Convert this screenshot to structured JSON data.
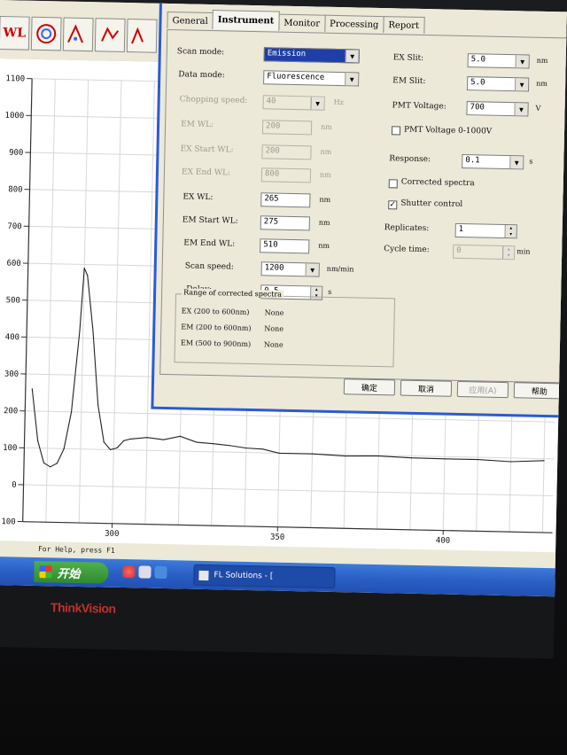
{
  "toolbar": {
    "icons": [
      "wl-icon",
      "target-icon",
      "peak-icon",
      "undo-icon",
      "zoom-icon"
    ],
    "wl_text": "WL"
  },
  "chart_data": {
    "type": "line",
    "yticks": [
      "1100",
      "1000",
      "900",
      "800",
      "700",
      "600",
      "500",
      "400",
      "300",
      "200",
      "100",
      "0",
      "-100"
    ],
    "xticks": [
      "300",
      "350",
      "400"
    ],
    "x": [
      275,
      277,
      279,
      281,
      283,
      285,
      287,
      289,
      290,
      291,
      293,
      295,
      297,
      299,
      301,
      303,
      305,
      310,
      315,
      320,
      325,
      330,
      335,
      340,
      345,
      350,
      360,
      370,
      380,
      390,
      400,
      410,
      420,
      430
    ],
    "y": [
      260,
      120,
      60,
      50,
      60,
      100,
      200,
      420,
      590,
      570,
      420,
      220,
      120,
      100,
      105,
      125,
      130,
      135,
      130,
      140,
      125,
      122,
      118,
      112,
      110,
      100,
      100,
      96,
      98,
      95,
      94,
      94,
      90,
      95
    ],
    "ylim": [
      -100,
      1100
    ],
    "xlim": [
      273,
      433
    ],
    "grid": true
  },
  "status": {
    "text": "For Help, press F1"
  },
  "taskbar": {
    "start": "开始",
    "task_label": "FL Solutions - ["
  },
  "brand": "ThinkVision",
  "dialog": {
    "tabs": [
      "General",
      "Instrument",
      "Monitor",
      "Processing",
      "Report"
    ],
    "active_tab": "Instrument",
    "left": {
      "scan_mode": {
        "label": "Scan mode:",
        "value": "Emission"
      },
      "data_mode": {
        "label": "Data mode:",
        "value": "Fluorescence"
      },
      "chopping_speed": {
        "label": "Chopping speed:",
        "value": "40",
        "unit": "Hz"
      },
      "em_wl": {
        "label": "EM WL:",
        "value": "200",
        "unit": "nm"
      },
      "ex_start_wl": {
        "label": "EX Start WL:",
        "value": "200",
        "unit": "nm"
      },
      "ex_end_wl": {
        "label": "EX End WL:",
        "value": "800",
        "unit": "nm"
      },
      "ex_wl": {
        "label": "EX WL:",
        "value": "265",
        "unit": "nm"
      },
      "em_start_wl": {
        "label": "EM Start WL:",
        "value": "275",
        "unit": "nm"
      },
      "em_end_wl": {
        "label": "EM End WL:",
        "value": "510",
        "unit": "nm"
      },
      "scan_speed": {
        "label": "Scan speed:",
        "value": "1200",
        "unit": "nm/min"
      },
      "delay": {
        "label": "Delay:",
        "value": "0.5",
        "unit": "s"
      }
    },
    "right": {
      "ex_slit": {
        "label": "EX Slit:",
        "value": "5.0",
        "unit": "nm"
      },
      "em_slit": {
        "label": "EM Slit:",
        "value": "5.0",
        "unit": "nm"
      },
      "pmt_voltage": {
        "label": "PMT Voltage:",
        "value": "700",
        "unit": "V"
      },
      "pmt_range": {
        "label": "PMT Voltage 0-1000V"
      },
      "response": {
        "label": "Response:",
        "value": "0.1",
        "unit": "s"
      },
      "corrected": {
        "label": "Corrected spectra"
      },
      "shutter": {
        "label": "Shutter control"
      },
      "replicates": {
        "label": "Replicates:",
        "value": "1"
      },
      "cycle_time": {
        "label": "Cycle time:",
        "value": "0",
        "unit": "min"
      }
    },
    "corrected_range": {
      "title": "Range of corrected spectra",
      "rows": [
        {
          "range": "EX  (200 to 600nm)",
          "status": "None"
        },
        {
          "range": "EM  (200 to 600nm)",
          "status": "None"
        },
        {
          "range": "EM  (500 to 900nm)",
          "status": "None"
        }
      ]
    },
    "buttons": {
      "ok": "确定",
      "cancel": "取消",
      "apply": "应用(A)",
      "help": "帮助"
    }
  }
}
